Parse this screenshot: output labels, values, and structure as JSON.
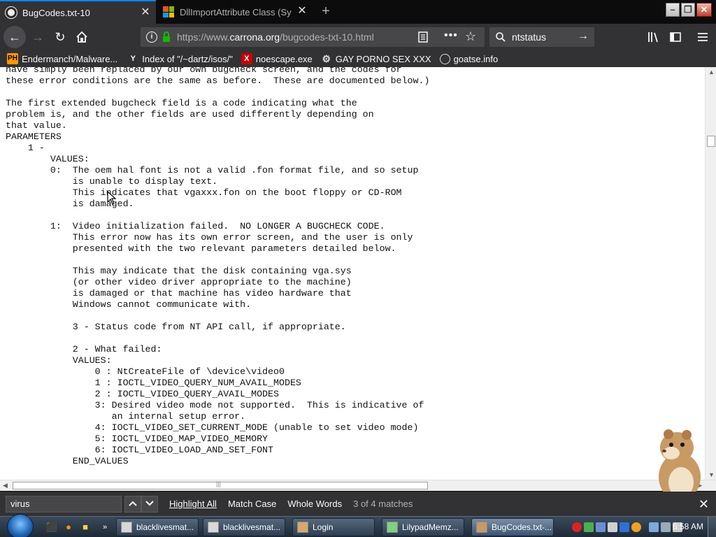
{
  "tabs": [
    {
      "title": "BugCodes.txt-10",
      "active": true
    },
    {
      "title": "DllImportAttribute Class (Syste",
      "active": false
    }
  ],
  "urlbar": {
    "url_prefix": "https://www.",
    "url_domain": "carrona.org",
    "url_path": "/bugcodes-txt-10.html"
  },
  "search": {
    "value": "ntstatus"
  },
  "bookmarks": [
    {
      "label": "Endermanch/Malware...",
      "icon": "PH"
    },
    {
      "label": "Index of \"/~dartz/isos/\"",
      "icon": "Y"
    },
    {
      "label": "noescape.exe",
      "icon": "X"
    },
    {
      "label": "GAY PORNO SEX XXX",
      "icon": "gear"
    },
    {
      "label": "goatse.info",
      "icon": "globe"
    }
  ],
  "page_text": "have simply been replaced by our own bugcheck screen, and the codes for\nthese error conditions are the same as before.  These are documented below.)\n\nThe first extended bugcheck field is a code indicating what the\nproblem is, and the other fields are used differently depending on\nthat value.\nPARAMETERS\n    1 -\n        VALUES:\n        0:  The oem hal font is not a valid .fon format file, and so setup\n            is unable to display text.\n            This indicates that vgaxxx.fon on the boot floppy or CD-ROM\n            is damaged.\n\n        1:  Video initialization failed.  NO LONGER A BUGCHECK CODE.\n            This error now has its own error screen, and the user is only\n            presented with the two relevant parameters detailed below.\n\n            This may indicate that the disk containing vga.sys\n            (or other video driver appropriate to the machine)\n            is damaged or that machine has video hardware that\n            Windows cannot communicate with.\n\n            3 - Status code from NT API call, if appropriate.\n\n            2 - What failed:\n            VALUES:\n                0 : NtCreateFile of \\device\\video0\n                1 : IOCTL_VIDEO_QUERY_NUM_AVAIL_MODES\n                2 : IOCTL_VIDEO_QUERY_AVAIL_MODES\n                3: Desired video mode not supported.  This is indicative of\n                   an internal setup error.\n                4: IOCTL_VIDEO_SET_CURRENT_MODE (unable to set video mode)\n                5: IOCTL_VIDEO_MAP_VIDEO_MEMORY\n                6: IOCTL_VIDEO_LOAD_AND_SET_FONT\n            END_VALUES",
  "findbar": {
    "query": "virus",
    "highlight_all": "Highlight All",
    "match_case": "Match Case",
    "whole_words": "Whole Words",
    "status": "3 of 4 matches"
  },
  "taskbar": {
    "tasks": [
      {
        "label": "blacklivesmat...",
        "active": false
      },
      {
        "label": "blacklivesmat...",
        "active": false
      },
      {
        "label": "Login",
        "active": false
      },
      {
        "label": "LilypadMemz...",
        "active": false
      },
      {
        "label": "BugCodes.txt-...",
        "active": true
      }
    ],
    "clock": "6:58 AM"
  },
  "colors": {
    "accent": "#0a84ff",
    "toolbar": "#323234",
    "tabstrip": "#0c0c0d",
    "lock_green": "#12bc00"
  }
}
